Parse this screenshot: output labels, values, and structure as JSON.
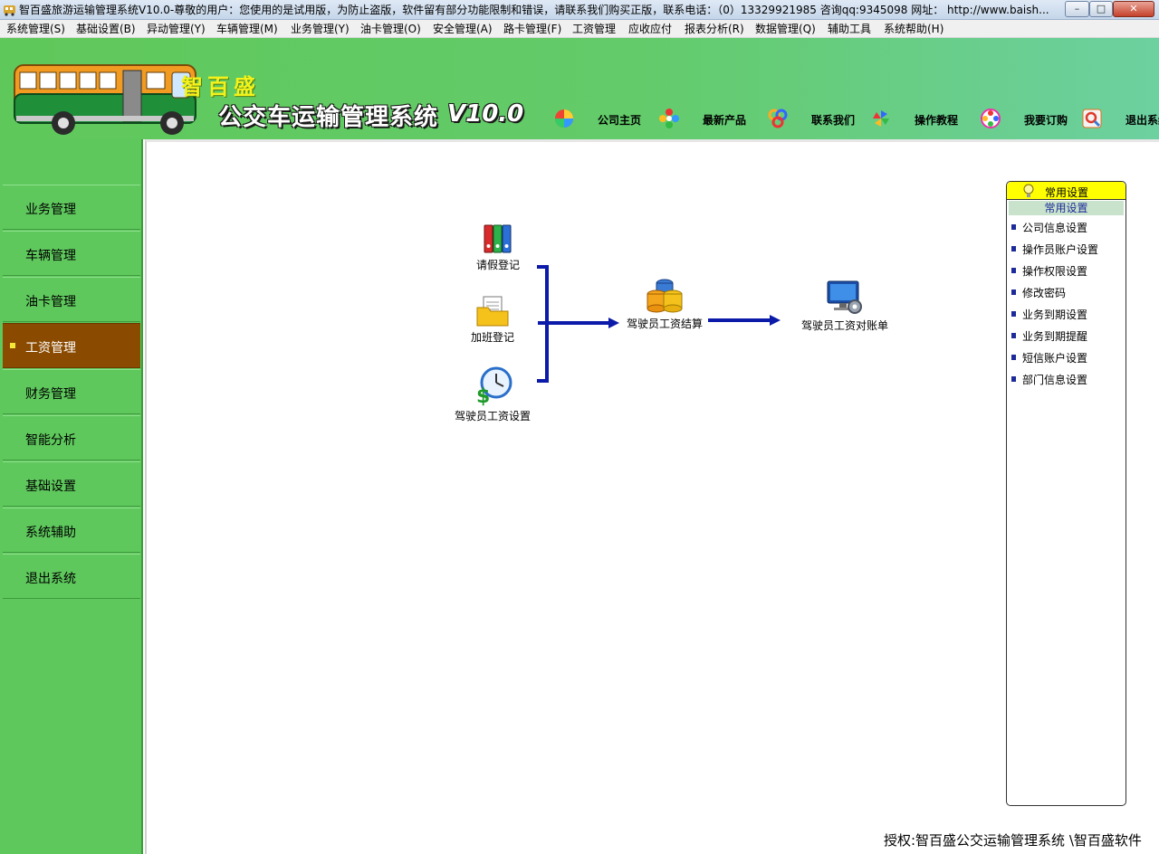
{
  "window": {
    "title": "智百盛旅游运输管理系统V10.0-尊敬的用户：您使用的是试用版，为防止盗版，软件留有部分功能限制和错误，请联系我们购买正版，联系电话：（0）13329921985  咨询qq:9345098   网址：  http://www.baish...",
    "minimize_label": "–",
    "maximize_label": "□",
    "close_label": "✕"
  },
  "menubar": [
    "系统管理(S)",
    "基础设置(B)",
    "异动管理(Y)",
    "车辆管理(M)",
    "业务管理(Y)",
    "油卡管理(O)",
    "安全管理(A)",
    "路卡管理(F)",
    "工资管理",
    "应收应付",
    "报表分析(R)",
    "数据管理(Q)",
    "辅助工具",
    "系统帮助(H)"
  ],
  "header": {
    "brand": "智百盛",
    "system_name": "公交车运输管理系统",
    "version": "V10.0",
    "nav": [
      {
        "label": "公司主页",
        "icon": "pie-colorful-icon"
      },
      {
        "label": "最新产品",
        "icon": "flower-colorful-icon"
      },
      {
        "label": "联系我们",
        "icon": "rings-colorful-icon"
      },
      {
        "label": "操作教程",
        "icon": "pinwheel-icon"
      },
      {
        "label": "我要订购",
        "icon": "cart-colorful-icon"
      },
      {
        "label": "退出系统",
        "icon": "magnifier-exit-icon"
      }
    ]
  },
  "sidebar": {
    "items": [
      {
        "label": "业务管理",
        "active": false
      },
      {
        "label": "车辆管理",
        "active": false
      },
      {
        "label": "油卡管理",
        "active": false
      },
      {
        "label": "工资管理",
        "active": true
      },
      {
        "label": "财务管理",
        "active": false
      },
      {
        "label": "智能分析",
        "active": false
      },
      {
        "label": "基础设置",
        "active": false
      },
      {
        "label": "系统辅助",
        "active": false
      },
      {
        "label": "退出系统",
        "active": false
      }
    ]
  },
  "flow": {
    "nodes": {
      "leave": "请假登记",
      "overtime": "加班登记",
      "salary_setting": "驾驶员工资设置",
      "settlement": "驾驶员工资结算",
      "statement": "驾驶员工资对账单"
    }
  },
  "settings_panel": {
    "title": "常用设置",
    "subtitle": "常用设置",
    "items": [
      "公司信息设置",
      "操作员账户设置",
      "操作权限设置",
      "修改密码",
      "业务到期设置",
      "业务到期提醒",
      "短信账户设置",
      "部门信息设置"
    ]
  },
  "footer": {
    "copyright": "授权:智百盛公交运输管理系统 \\智百盛软件"
  },
  "colors": {
    "header_green": "#5fc85a",
    "sidebar_green": "#5ec85c",
    "active_item": "#8a4a00",
    "arrow_blue": "#0b1aa8",
    "panel_yellow": "#ffff00"
  }
}
